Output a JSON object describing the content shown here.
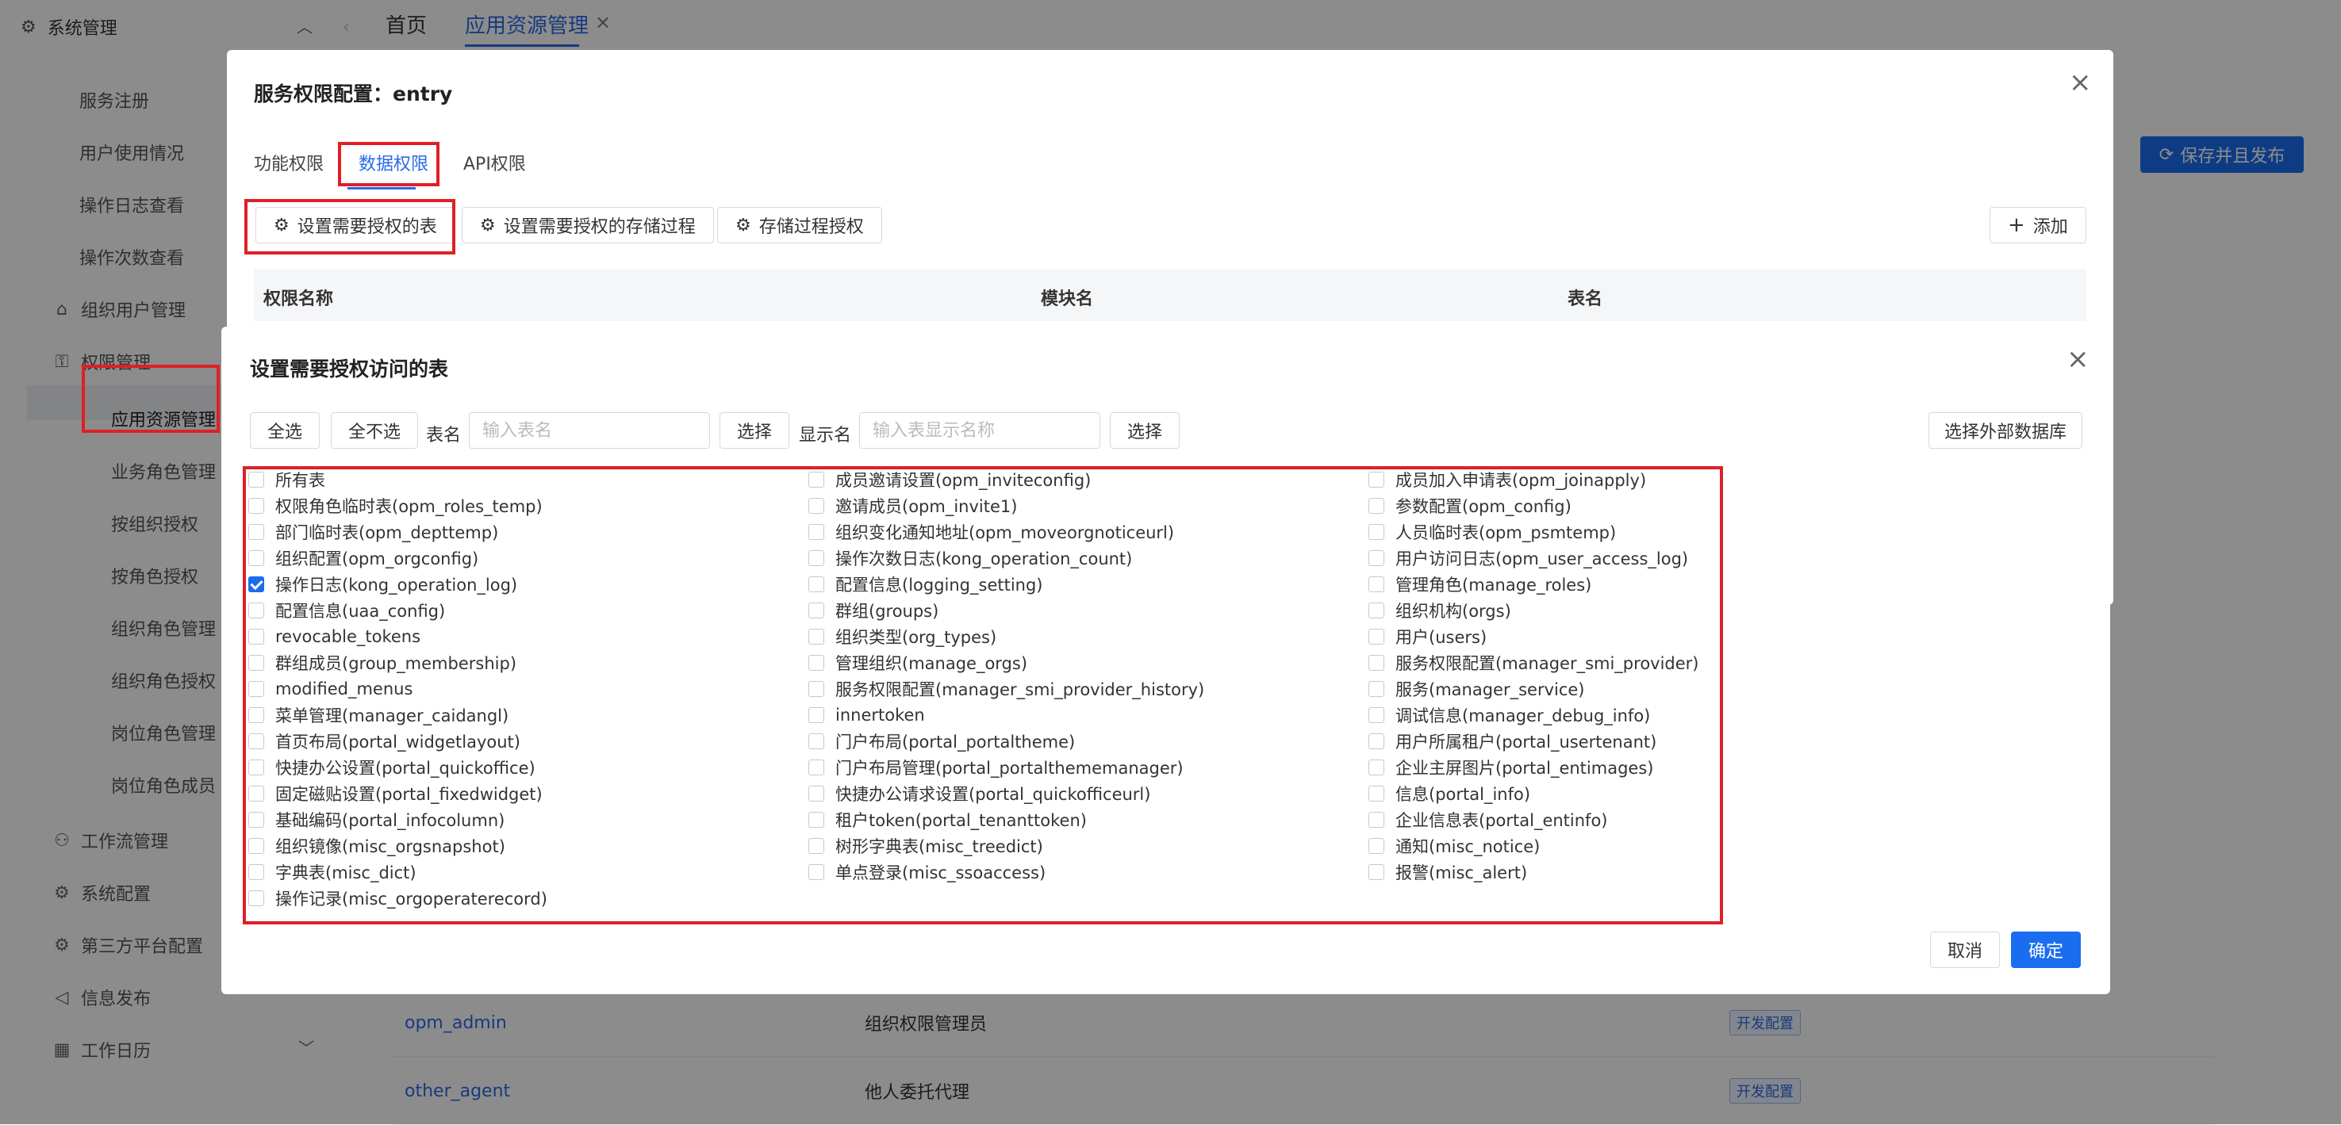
{
  "sidebar": {
    "top": {
      "label": "系统管理"
    },
    "items": [
      {
        "label": "服务注册"
      },
      {
        "label": "用户使用情况"
      },
      {
        "label": "操作日志查看"
      },
      {
        "label": "操作次数查看"
      },
      {
        "label": "组织用户管理"
      },
      {
        "label": "权限管理"
      },
      {
        "label": "应用资源管理"
      },
      {
        "label": "业务角色管理"
      },
      {
        "label": "按组织授权"
      },
      {
        "label": "按角色授权"
      },
      {
        "label": "组织角色管理"
      },
      {
        "label": "组织角色授权"
      },
      {
        "label": "岗位角色管理"
      },
      {
        "label": "岗位角色成员"
      },
      {
        "label": "工作流管理"
      },
      {
        "label": "系统配置"
      },
      {
        "label": "第三方平台配置"
      },
      {
        "label": "信息发布"
      },
      {
        "label": "工作日历"
      }
    ]
  },
  "tabs": {
    "home": "首页",
    "current": "应用资源管理"
  },
  "toolbar": {
    "publish_label": "保存并且发布"
  },
  "background_rows": [
    {
      "name": "opm_admin",
      "desc": "组织权限管理员",
      "tag": "开发配置"
    },
    {
      "name": "other_agent",
      "desc": "他人委托代理",
      "tag": "开发配置"
    }
  ],
  "dialog1": {
    "title": "服务权限配置：entry",
    "tabs": [
      "功能权限",
      "数据权限",
      "API权限"
    ],
    "buttons": {
      "set_tables": "设置需要授权的表",
      "set_procs": "设置需要授权的存储过程",
      "proc_auth": "存储过程授权",
      "add": "添加"
    },
    "columns": [
      "权限名称",
      "模块名",
      "表名"
    ]
  },
  "dialog2": {
    "title": "设置需要授权访问的表",
    "select_all": "全选",
    "select_none": "全不选",
    "table_name_label": "表名",
    "table_name_placeholder": "输入表名",
    "select_label": "选择",
    "display_name_label": "显示名",
    "display_name_placeholder": "输入表显示名称",
    "external_db_label": "选择外部数据库",
    "cancel_label": "取消",
    "confirm_label": "确定",
    "columns": [
      [
        {
          "label": "所有表",
          "checked": false
        },
        {
          "label": "权限角色临时表(opm_roles_temp)",
          "checked": false
        },
        {
          "label": "部门临时表(opm_depttemp)",
          "checked": false
        },
        {
          "label": "组织配置(opm_orgconfig)",
          "checked": false
        },
        {
          "label": "操作日志(kong_operation_log)",
          "checked": true
        },
        {
          "label": "配置信息(uaa_config)",
          "checked": false
        },
        {
          "label": "revocable_tokens",
          "checked": false
        },
        {
          "label": "群组成员(group_membership)",
          "checked": false
        },
        {
          "label": "modified_menus",
          "checked": false
        },
        {
          "label": "菜单管理(manager_caidangl)",
          "checked": false
        },
        {
          "label": "首页布局(portal_widgetlayout)",
          "checked": false
        },
        {
          "label": "快捷办公设置(portal_quickoffice)",
          "checked": false
        },
        {
          "label": "固定磁贴设置(portal_fixedwidget)",
          "checked": false
        },
        {
          "label": "基础编码(portal_infocolumn)",
          "checked": false
        },
        {
          "label": "组织镜像(misc_orgsnapshot)",
          "checked": false
        },
        {
          "label": "字典表(misc_dict)",
          "checked": false
        },
        {
          "label": "操作记录(misc_orgoperaterecord)",
          "checked": false
        }
      ],
      [
        {
          "label": "成员邀请设置(opm_inviteconfig)",
          "checked": false
        },
        {
          "label": "邀请成员(opm_invite1)",
          "checked": false
        },
        {
          "label": "组织变化通知地址(opm_moveorgnoticeurl)",
          "checked": false
        },
        {
          "label": "操作次数日志(kong_operation_count)",
          "checked": false
        },
        {
          "label": "配置信息(logging_setting)",
          "checked": false
        },
        {
          "label": "群组(groups)",
          "checked": false
        },
        {
          "label": "组织类型(org_types)",
          "checked": false
        },
        {
          "label": "管理组织(manage_orgs)",
          "checked": false
        },
        {
          "label": "服务权限配置(manager_smi_provider_history)",
          "checked": false
        },
        {
          "label": "innertoken",
          "checked": false
        },
        {
          "label": "门户布局(portal_portaltheme)",
          "checked": false
        },
        {
          "label": "门户布局管理(portal_portalthememanager)",
          "checked": false
        },
        {
          "label": "快捷办公请求设置(portal_quickofficeurl)",
          "checked": false
        },
        {
          "label": "租户token(portal_tenanttoken)",
          "checked": false
        },
        {
          "label": "树形字典表(misc_treedict)",
          "checked": false
        },
        {
          "label": "单点登录(misc_ssoaccess)",
          "checked": false
        }
      ],
      [
        {
          "label": "成员加入申请表(opm_joinapply)",
          "checked": false
        },
        {
          "label": "参数配置(opm_config)",
          "checked": false
        },
        {
          "label": "人员临时表(opm_psmtemp)",
          "checked": false
        },
        {
          "label": "用户访问日志(opm_user_access_log)",
          "checked": false
        },
        {
          "label": "管理角色(manage_roles)",
          "checked": false
        },
        {
          "label": "组织机构(orgs)",
          "checked": false
        },
        {
          "label": "用户(users)",
          "checked": false
        },
        {
          "label": "服务权限配置(manager_smi_provider)",
          "checked": false
        },
        {
          "label": "服务(manager_service)",
          "checked": false
        },
        {
          "label": "调试信息(manager_debug_info)",
          "checked": false
        },
        {
          "label": "用户所属租户(portal_usertenant)",
          "checked": false
        },
        {
          "label": "企业主屏图片(portal_entimages)",
          "checked": false
        },
        {
          "label": "信息(portal_info)",
          "checked": false
        },
        {
          "label": "企业信息表(portal_entinfo)",
          "checked": false
        },
        {
          "label": "通知(misc_notice)",
          "checked": false
        },
        {
          "label": "报警(misc_alert)",
          "checked": false
        }
      ]
    ]
  },
  "colors": {
    "accent": "#1b6df0",
    "highlight": "#e01f26",
    "mask": "rgba(0,0,0,0.45)"
  }
}
